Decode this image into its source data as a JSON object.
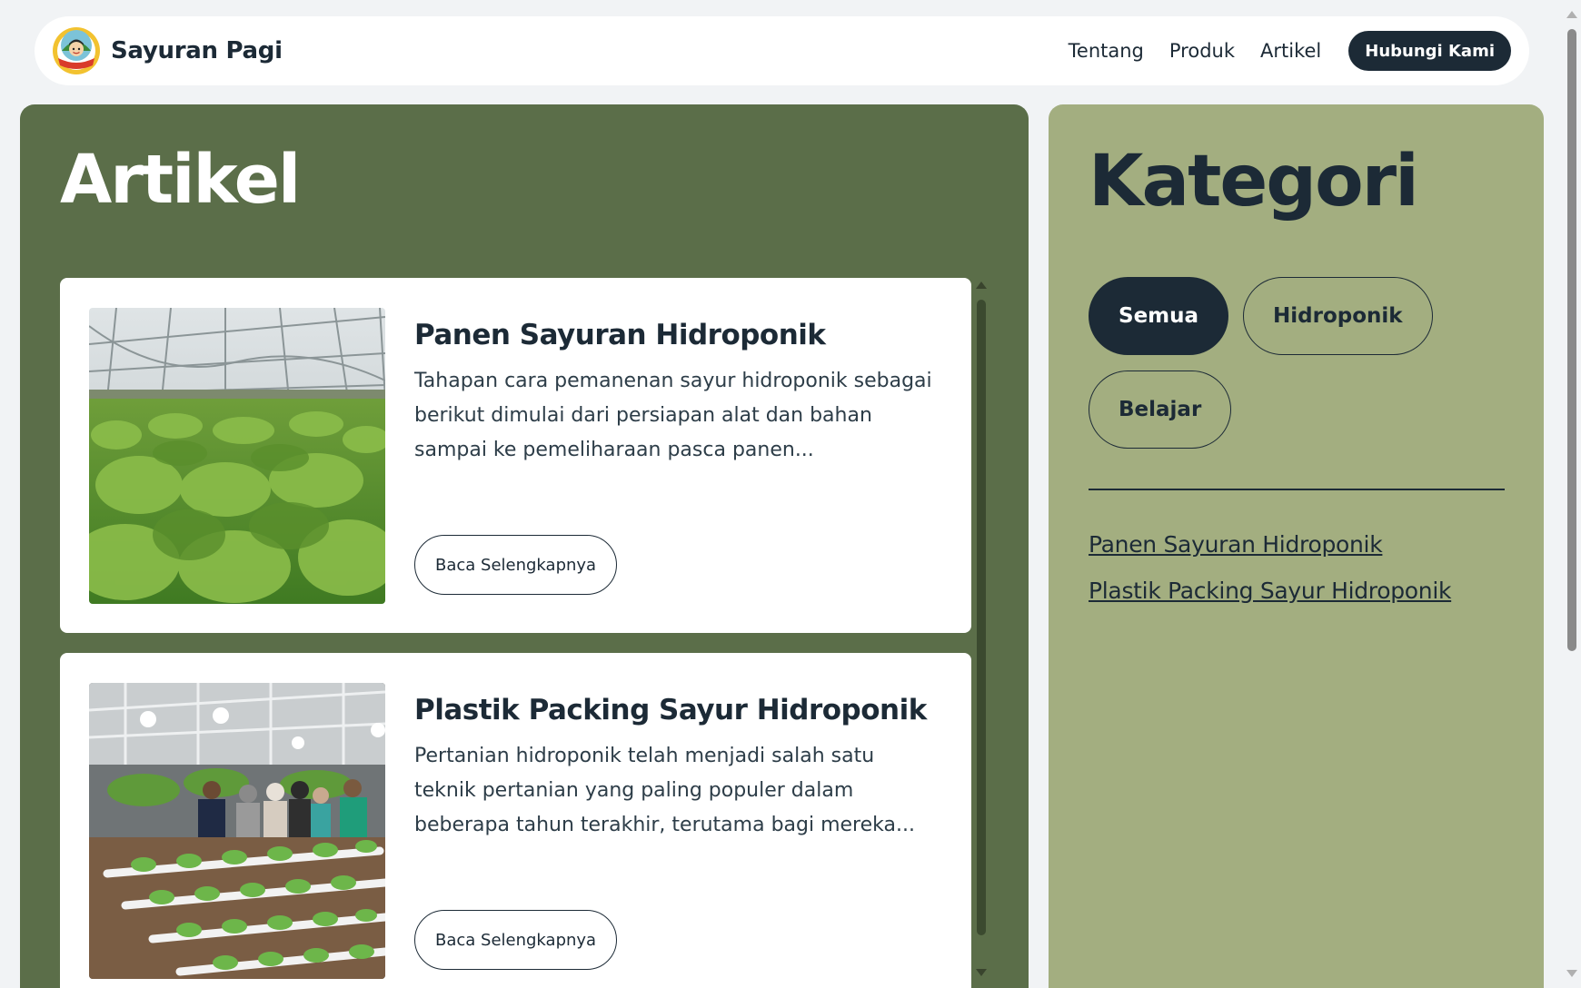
{
  "navbar": {
    "brand_name": "Sayuran Pagi",
    "logo_text": "Sayuran Pagi",
    "links": [
      "Tentang",
      "Produk",
      "Artikel"
    ],
    "cta_label": "Hubungi Kami"
  },
  "main": {
    "title": "Artikel",
    "articles": [
      {
        "title": "Panen Sayuran Hidroponik",
        "excerpt": "Tahapan cara pemanenan sayur hidroponik sebagai berikut dimulai dari persiapan alat dan bahan sampai ke pemeliharaan pasca panen...",
        "button_label": "Baca Selengkapnya",
        "image": "greenhouse-leafy-vegetables-photo"
      },
      {
        "title": "Plastik Packing Sayur Hidroponik",
        "excerpt": "Pertanian hidroponik telah menjadi salah satu teknik pertanian yang paling populer dalam beberapa tahun terakhir, terutama bagi mereka...",
        "button_label": "Baca Selengkapnya",
        "image": "people-in-hydroponic-greenhouse-photo"
      }
    ]
  },
  "sidebar": {
    "title": "Kategori",
    "categories": [
      "Semua",
      "Hidroponik",
      "Belajar"
    ],
    "active_category": "Semua",
    "links": [
      "Panen Sayuran Hidroponik",
      "Plastik Packing Sayur Hidroponik"
    ]
  },
  "colors": {
    "main_panel": "#5b6e49",
    "sidebar_panel": "#a3ae80",
    "dark": "#1c2a36"
  }
}
